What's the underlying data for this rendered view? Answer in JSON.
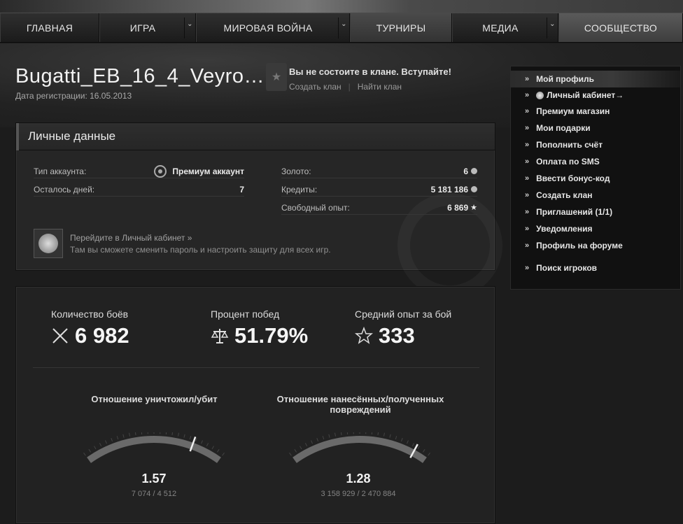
{
  "nav": {
    "items": [
      {
        "label": "ГЛАВНАЯ"
      },
      {
        "label": "ИГРА"
      },
      {
        "label": "МИРОВАЯ ВОЙНА"
      },
      {
        "label": "ТУРНИРЫ"
      },
      {
        "label": "МЕДИА"
      },
      {
        "label": "СООБЩЕСТВО"
      }
    ]
  },
  "profile": {
    "username": "Bugatti_EB_16_4_Veyro…",
    "reg_date": "Дата регистрации: 16.05.2013"
  },
  "clan": {
    "title": "Вы не состоите в клане. Вступайте!",
    "create_link": "Создать клан",
    "find_link": "Найти клан"
  },
  "personal": {
    "title": "Личные данные",
    "account_type_label": "Тип аккаунта:",
    "account_type_value": "Премиум аккаунт",
    "days_left_label": "Осталось дней:",
    "days_left_value": "7",
    "gold_label": "Золото:",
    "gold_value": "6",
    "credits_label": "Кредиты:",
    "credits_value": "5 181 186",
    "free_xp_label": "Свободный опыт:",
    "free_xp_value": "6 869",
    "cabinet_link": "Перейдите в Личный кабинет »",
    "cabinet_desc": "Там вы сможете сменить пароль и настроить защиту для всех игр."
  },
  "stats": {
    "battles_label": "Количество боёв",
    "battles_value": "6 982",
    "winrate_label": "Процент побед",
    "winrate_value": "51.79%",
    "avg_xp_label": "Средний опыт за бой",
    "avg_xp_value": "333",
    "kd_title": "Отношение уничтожил/убит",
    "kd_value": "1.57",
    "kd_sub": "7 074 / 4 512",
    "kd_gauge_fraction": 0.78,
    "dmg_title_line1": "Отношение нанесённых/полученных",
    "dmg_title_line2": "повреждений",
    "dmg_value": "1.28",
    "dmg_sub": "3 158 929 / 2 470 884",
    "dmg_gauge_fraction": 0.9
  },
  "sidebar": {
    "items": [
      {
        "label": "Мой профиль"
      },
      {
        "label": "Личный кабинет→"
      },
      {
        "label": "Премиум магазин"
      },
      {
        "label": "Мои подарки"
      },
      {
        "label": "Пополнить счёт"
      },
      {
        "label": "Оплата по SMS"
      },
      {
        "label": "Ввести бонус-код"
      },
      {
        "label": "Создать клан"
      },
      {
        "label": "Приглашений (1/1)"
      },
      {
        "label": "Уведомления"
      },
      {
        "label": "Профиль на форуме"
      },
      {
        "label": "Поиск игроков"
      }
    ],
    "chevron": "»"
  }
}
